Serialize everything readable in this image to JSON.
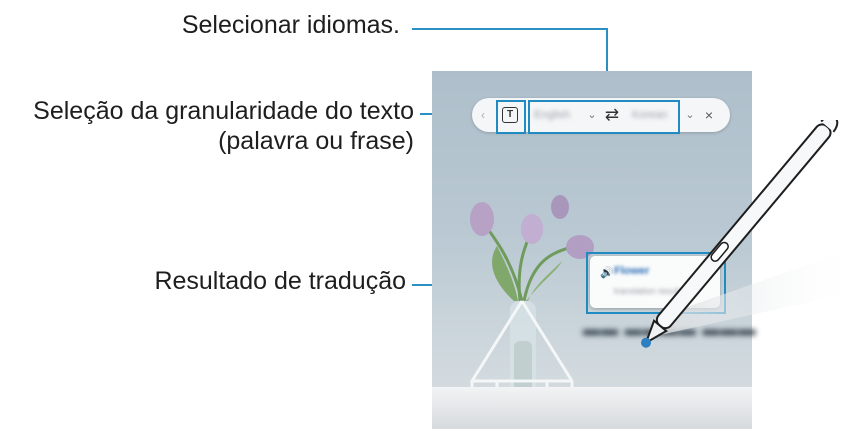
{
  "callouts": {
    "languages": "Selecionar idiomas.",
    "granularity_line1": "Seleção da granularidade do texto",
    "granularity_line2": "(palavra ou frase)",
    "result": "Resultado de tradução"
  },
  "toolbar": {
    "more_icon": "chevron-left-icon",
    "text_mode_icon": "T",
    "source_language": "English",
    "swap_icon": "⇄",
    "target_language": "Korean",
    "close_icon": "×"
  },
  "translation": {
    "word": "Flower",
    "detail": "translation result"
  },
  "colors": {
    "callout_line": "#2b8fc1",
    "highlight": "#1f8bc1",
    "accent_blue": "#2d6fb8"
  }
}
